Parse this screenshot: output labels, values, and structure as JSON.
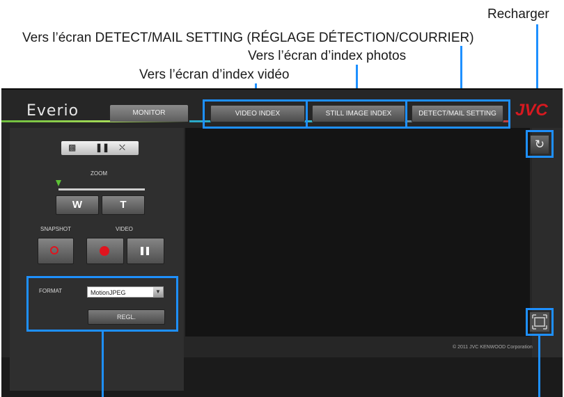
{
  "callouts": {
    "reload": "Recharger",
    "detect_mail": "Vers l’écran DETECT/MAIL SETTING (RÉGLAGE DÉTECTION/COURRIER)",
    "still_index": "Vers l’écran d’index photos",
    "video_index": "Vers l’écran d’index vidéo"
  },
  "app": {
    "brand": "Everio",
    "manufacturer": "JVC",
    "tabs": {
      "monitor": "MONITOR",
      "video_index": "VIDEO INDEX",
      "still_index": "STILL IMAGE INDEX",
      "detect_mail": "DETECT/MAIL SETTING"
    },
    "controls": {
      "zoom_label": "ZOOM",
      "zoom_wide": "W",
      "zoom_tele": "T",
      "snapshot_label": "SNAPSHOT",
      "video_label": "VIDEO",
      "format_label": "FORMAT",
      "format_value": "MotionJPEG",
      "set_button": "REGL.",
      "zoom_level": 0
    },
    "copyright": "© 2011 JVC KENWOOD Corporation"
  },
  "colors": {
    "highlight": "#1e90ff",
    "record": "#e0141e",
    "brand_red": "#d71920",
    "zoom_indicator": "#5dc236"
  },
  "icons": [
    "camera-icon",
    "pause-icon",
    "plug-icon",
    "record-icon",
    "refresh-icon",
    "fullscreen-icon",
    "dropdown-arrow-icon"
  ]
}
